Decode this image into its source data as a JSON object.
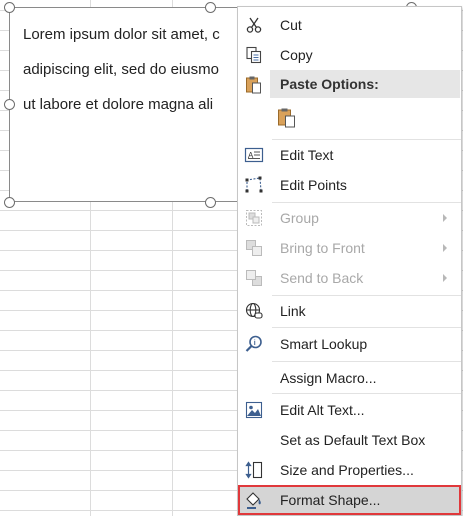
{
  "textbox": {
    "lines": [
      "Lorem ipsum dolor sit amet, c",
      "adipiscing elit, sed do eiusmo",
      "ut labore et dolore magna ali"
    ]
  },
  "menu": {
    "cut": "Cut",
    "copy": "Copy",
    "paste_options": "Paste Options:",
    "edit_text": "Edit Text",
    "edit_points": "Edit Points",
    "group": "Group",
    "bring_to_front": "Bring to Front",
    "send_to_back": "Send to Back",
    "link": "Link",
    "smart_lookup": "Smart Lookup",
    "assign_macro": "Assign Macro...",
    "edit_alt_text": "Edit Alt Text...",
    "set_default_text_box": "Set as Default Text Box",
    "size_and_properties": "Size and Properties...",
    "format_shape": "Format Shape..."
  },
  "icons": {
    "cut": "scissors-icon",
    "copy": "copy-icon",
    "paste_header": "clipboard-icon",
    "paste_keep": "paste-icon",
    "edit_text": "edit-text-icon",
    "edit_points": "edit-points-icon",
    "group": "group-icon",
    "bring_to_front": "bring-to-front-icon",
    "send_to_back": "send-to-back-icon",
    "link": "globe-link-icon",
    "smart_lookup": "search-icon",
    "edit_alt_text": "image-icon",
    "size_and_properties": "size-icon",
    "format_shape": "paint-bucket-icon"
  },
  "colors": {
    "highlight_border": "#e0383b",
    "highlight_fill": "#d5d5d5",
    "paste_header_fill": "#e6e6e6",
    "disabled_text": "#a8a8a8"
  }
}
